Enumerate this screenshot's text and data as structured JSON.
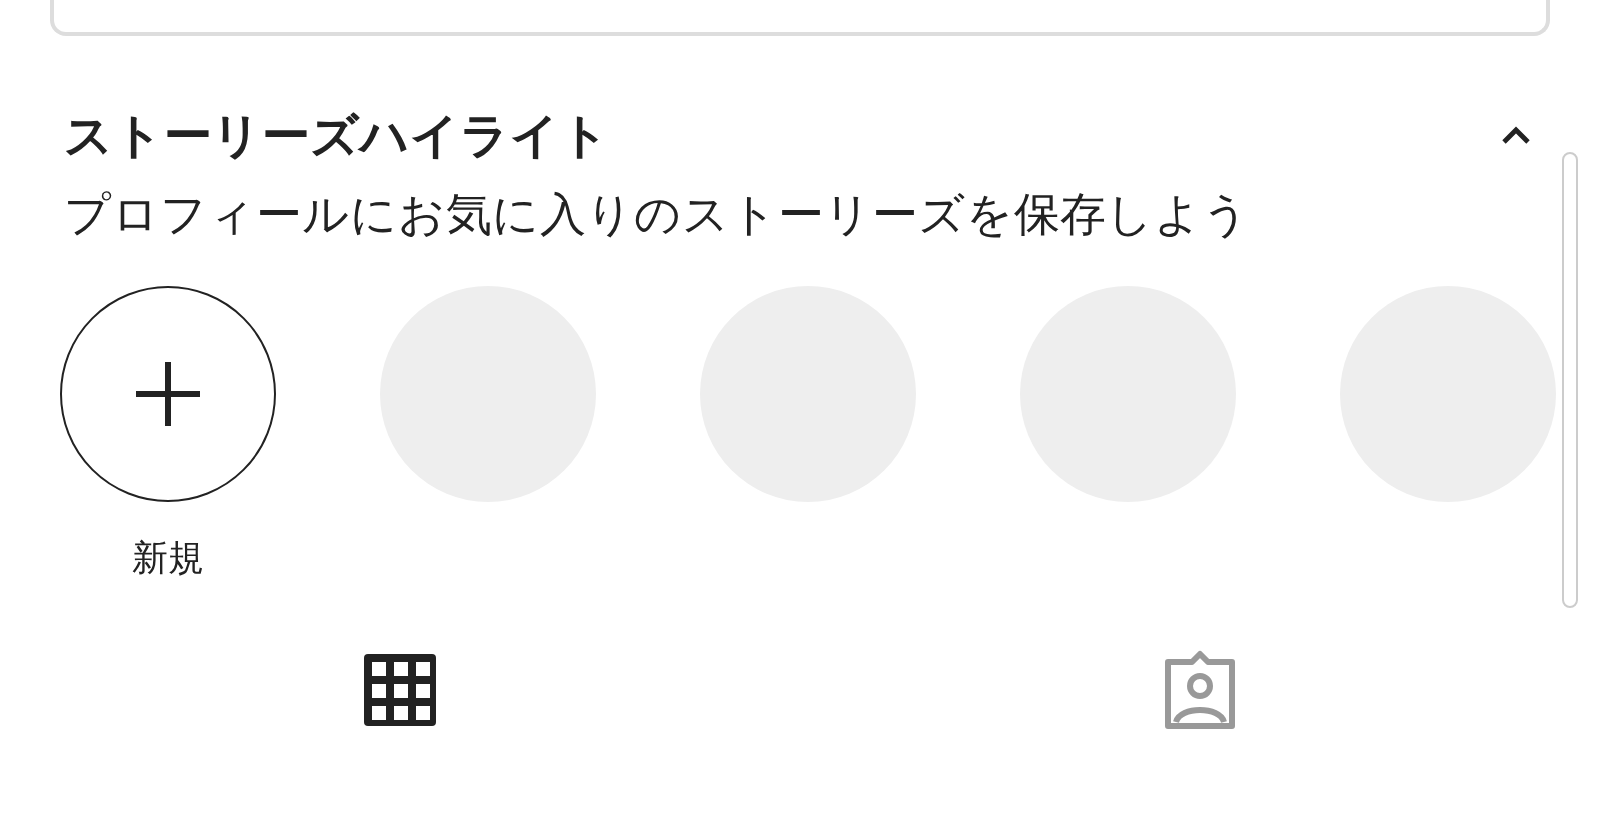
{
  "highlights": {
    "title": "ストーリーズハイライト",
    "subtitle": "プロフィールにお気に入りのストーリーズを保存しよう",
    "expanded": true,
    "items": [
      {
        "kind": "new",
        "label": "新規"
      },
      {
        "kind": "placeholder"
      },
      {
        "kind": "placeholder"
      },
      {
        "kind": "placeholder"
      },
      {
        "kind": "placeholder"
      }
    ]
  },
  "tabs": [
    {
      "kind": "grid",
      "selected": true
    },
    {
      "kind": "tagged",
      "selected": false
    }
  ]
}
